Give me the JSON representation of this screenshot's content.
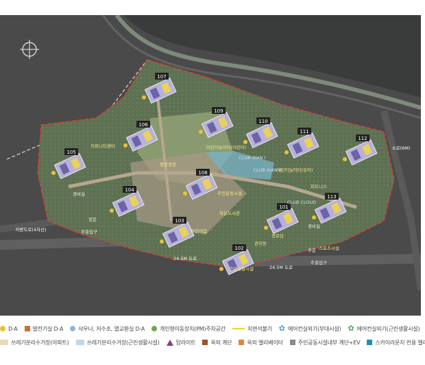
{
  "map": {
    "buildings": [
      {
        "label": "107"
      },
      {
        "label": "106"
      },
      {
        "label": "105"
      },
      {
        "label": "109"
      },
      {
        "label": "110"
      },
      {
        "label": "111"
      },
      {
        "label": "112"
      },
      {
        "label": "108"
      },
      {
        "label": "104"
      },
      {
        "label": "103"
      },
      {
        "label": "102"
      },
      {
        "label": "101"
      },
      {
        "label": "113"
      }
    ],
    "places": [
      {
        "text": "커뮤니티센터"
      },
      {
        "text": "어린이놀이터(어린이)"
      },
      {
        "text": "어린이놀이터(유아)"
      },
      {
        "text": "중앙광장"
      },
      {
        "text": "주민운동시설"
      },
      {
        "text": "작은도서관"
      },
      {
        "text": "피트니스"
      },
      {
        "text": "어린이집"
      },
      {
        "text": "경로당"
      },
      {
        "text": "스포츠시설"
      },
      {
        "text": "관리동"
      },
      {
        "text": "근린생활시설"
      }
    ],
    "gates": [
      {
        "text": "정문"
      },
      {
        "text": "후문"
      },
      {
        "text": "부출입구"
      },
      {
        "text": "주출입구"
      },
      {
        "text": "경비실"
      },
      {
        "text": "경비실"
      }
    ],
    "roads": [
      {
        "text": "지방도로(4차선)"
      },
      {
        "text": "24.5M 도로"
      },
      {
        "text": "24.5M 도로"
      },
      {
        "text": "소로(6M)"
      }
    ],
    "club_labels": [
      "CLUB XIAN I",
      "CLUB XIAN II",
      "CLUB CLOUD"
    ]
  },
  "legend": {
    "row1": [
      {
        "icon": "yellow-circle",
        "color": "#e8c23a",
        "label": "D·A"
      },
      {
        "icon": "orange-square",
        "color": "#c8703a",
        "label": "발전기실 D·A"
      },
      {
        "icon": "blue-circle",
        "color": "#8fb3d9",
        "label": "샤우나, 저수조, 열교환실 D·A"
      },
      {
        "icon": "green-circle",
        "color": "#6aa84f",
        "label": "개인형이동장치(PM)주차공간"
      },
      {
        "icon": "yellow-line",
        "color": "#f0cf4f",
        "label": "지면석불기"
      },
      {
        "icon": "blue-flower",
        "color": "#4d9bd6",
        "label": "에어컨실외기(부대시설)"
      },
      {
        "icon": "green-flower",
        "color": "#5aa05a",
        "label": "에어컨실외기(근린생활시설)"
      }
    ],
    "row2": [
      {
        "icon": "beige-hatch",
        "color": "#ead9b8",
        "label": "쓰레기분리수거장(아파트)"
      },
      {
        "icon": "blue-hatch",
        "color": "#c2d5ea",
        "label": "쓰레기분리수거장(근린생활시설)"
      },
      {
        "icon": "purple-triangle",
        "color": "#8e3a82",
        "label": "탑라이트"
      },
      {
        "icon": "brown-square",
        "color": "#a0522d",
        "label": "옥외 계단"
      },
      {
        "icon": "orange-square",
        "color": "#d98a3a",
        "label": "옥외 엘리베이터"
      },
      {
        "icon": "gray-square",
        "color": "#8a8a8a",
        "label": "주민공동시설내부 계단+EV"
      },
      {
        "icon": "teal-square",
        "color": "#1f8fb3",
        "label": "스카이라운지 전용 엘리베이터"
      }
    ]
  }
}
